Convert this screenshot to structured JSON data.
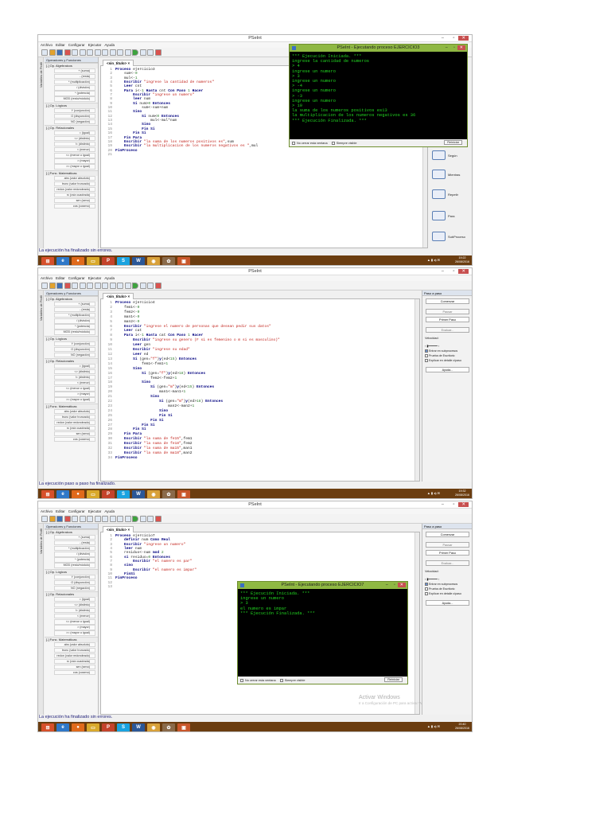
{
  "app": {
    "title": "PSeInt",
    "menu": [
      "Archivo",
      "Editar",
      "Configurar",
      "Ejecutar",
      "Ayuda"
    ],
    "editor_tab": "<sin_titulo>",
    "side_tab": "Operadores y Funciones",
    "side_vert": "Variables de Perfil"
  },
  "panel": {
    "groups": [
      {
        "title": "[-]  Op. Algebraicos",
        "items": [
          "+ (suma)",
          "- (resta)",
          "* (multiplicación)",
          "/ (división)",
          "^ (potencia)",
          "MOD (resto/módulo)"
        ]
      },
      {
        "title": "[-]  Op. Lógicos",
        "items": [
          "Y (conjunción)",
          "O (disyunción)",
          "NO (negación)"
        ]
      },
      {
        "title": "[-]  Op. Relacionales",
        "items": [
          "= (igual)",
          "<> (distinto)",
          "!= (distinto)",
          "< (menor)",
          "<= (menor o igual)",
          "> (mayor)",
          ">= (mayor o igual)"
        ]
      },
      {
        "title": "[-]  Func. Matemáticas",
        "items": [
          "abs (valor absoluto)",
          "trunc (valor truncado)",
          "redon (valor redondeado)",
          "rc (raíz cuadrada)",
          "sen (seno)",
          "cos (coseno)"
        ]
      }
    ]
  },
  "shot1": {
    "code": [
      [
        "1",
        "Proceso ejercicio3"
      ],
      [
        "2",
        "    sum<-0"
      ],
      [
        "3",
        "    mul<-1"
      ],
      [
        "4",
        "    Escribir \"ingrese la cantidad de numeros\""
      ],
      [
        "5",
        "    Leer cnt"
      ],
      [
        "6",
        "    Para i<-1 Hasta cnt Con Paso 1 Hacer"
      ],
      [
        "7",
        "        Escribir \"ingrese un numero\""
      ],
      [
        "8",
        "        leer num"
      ],
      [
        "9",
        "        Si num>0 Entonces"
      ],
      [
        "10",
        "            sum<-sum+num"
      ],
      [
        "11",
        "        Sino"
      ],
      [
        "12",
        "            Si num<0 Entonces"
      ],
      [
        "13",
        "                mul<-mul*num"
      ],
      [
        "14",
        "            Sino"
      ],
      [
        "15",
        "            Fin Si"
      ],
      [
        "16",
        "        Fin Si"
      ],
      [
        "17",
        "    Fin Para"
      ],
      [
        "18",
        "    Escribir \"la suma de los numeros positivos es\",sum"
      ],
      [
        "19",
        "    Escribir \"la multiplicacion de los numeros negativos es \",mul"
      ],
      [
        "20",
        "FinProceso"
      ],
      [
        "21",
        ""
      ]
    ],
    "status": "La ejecución ha finalizado sin errores.",
    "console": {
      "title": "PSeInt - Ejecutando proceso EJERCICIO3",
      "lines": [
        "*** Ejecución Iniciada. ***",
        "ingrese la cantidad de numeros",
        "> 4",
        "ingrese un numero",
        "> 3",
        "ingrese un numero",
        "> -4",
        "ingrese un numero",
        "> -3",
        "ingrese un numero",
        "> 10",
        "la suma de los numeros positivos es13",
        "la multiplicacion de los numeros negativos es 36",
        "*** Ejecución Finalizada. ***"
      ],
      "no_cerrar": "No cerrar esta ventana",
      "siempre": "Siempre visible",
      "reiniciar": "Reiniciar"
    },
    "mini_buttons": [
      "Según",
      "Mientras",
      "Repetir",
      "Para",
      "SubProceso"
    ],
    "clock": "19:22",
    "date": "26/08/2016"
  },
  "shot2": {
    "code": [
      [
        "1",
        "Proceso ejercicio4"
      ],
      [
        "2",
        "    fem1<-0"
      ],
      [
        "3",
        "    fem2<-0"
      ],
      [
        "4",
        "    man1<-0"
      ],
      [
        "5",
        "    man2<-0"
      ],
      [
        "6",
        "    Escribir \"ingrese el numero de personas que desean pedir sus datos\""
      ],
      [
        "7",
        "    Leer cat"
      ],
      [
        "8",
        "    Para i<-1 Hasta cat Con Paso 1 Hacer"
      ],
      [
        "9",
        "        Escribir \"ingrese su genero (F si es femenino o m si es masculino)\""
      ],
      [
        "10",
        "        Leer gen"
      ],
      [
        "11",
        "        Escribir \"ingrese su edad\""
      ],
      [
        "12",
        "        Leer ed"
      ],
      [
        "13",
        "        Si (gen=\"f\")y(ed<15) Entonces"
      ],
      [
        "14",
        "            fem1<-fem1+1"
      ],
      [
        "15",
        "        Sino"
      ],
      [
        "16",
        "            Si (gen=\"f\")y(ed>18) Entonces"
      ],
      [
        "17",
        "                fem2<-fem2+1"
      ],
      [
        "18",
        "            Sino"
      ],
      [
        "19",
        "                Si (gen=\"m\")y(ed<15) Entonces"
      ],
      [
        "20",
        "                    man1<-man1+1"
      ],
      [
        "21",
        "                Sino"
      ],
      [
        "22",
        "                    Si (gen=\"m\")y(ed>18) Entonces"
      ],
      [
        "23",
        "                        man2<-man2+1"
      ],
      [
        "24",
        "                    Sino"
      ],
      [
        "25",
        "                    Fin Si"
      ],
      [
        "26",
        "                Fin Si"
      ],
      [
        "27",
        "            Fin Si"
      ],
      [
        "28",
        "        Fin Si"
      ],
      [
        "29",
        "    Fin Para"
      ],
      [
        "30",
        "    Escribir \"la suma de fe15\",fem1"
      ],
      [
        "31",
        "    Escribir \"la suma de fe18\",fem2"
      ],
      [
        "32",
        "    Escribir \"la suma de ma15\",man1"
      ],
      [
        "33",
        "    Escribir \"la suma de ma18\",man2"
      ],
      [
        "34",
        "FinProceso"
      ]
    ],
    "status": "La ejecución paso a paso ha finalizado.",
    "clock": "19:32",
    "date": "26/08/2016"
  },
  "shot3": {
    "code": [
      [
        "1",
        "Proceso ejercicio7"
      ],
      [
        "2",
        "    definir num Como Real"
      ],
      [
        "3",
        "    Escribir \"ingrese un numero\""
      ],
      [
        "4",
        "    leer num"
      ],
      [
        "5",
        "    residuo<-num mod 2"
      ],
      [
        "6",
        "    si residuo=0 Entonces"
      ],
      [
        "7",
        "        Escribir \"el numero es par\""
      ],
      [
        "8",
        "    sino"
      ],
      [
        "9",
        "        Escribir \"el numero es impar\""
      ],
      [
        "10",
        "    FinSi"
      ],
      [
        "11",
        "FinProceso"
      ],
      [
        "12",
        ""
      ],
      [
        "13",
        ""
      ]
    ],
    "status": "La ejecución ha finalizado sin errores.",
    "console": {
      "title": "PSeInt - Ejecutando proceso EJERCICIO7",
      "lines": [
        "*** Ejecución Iniciada. ***",
        "ingrese un numero",
        "> 3",
        "el numero es impar",
        "*** Ejecución Finalizada. ***"
      ],
      "no_cerrar": "No cerrar esta ventana",
      "siempre": "Siempre visible",
      "reiniciar": "Reiniciar"
    },
    "watermark": "Activar Windows",
    "watermark_sub": "Ir a Configuración de PC para activar Windows.",
    "clock": "20:40",
    "date": "26/08/2016"
  },
  "step_panel": {
    "title": "Paso a paso",
    "comenzar": "Comenzar",
    "pausar": "Pausar",
    "primer_paso": "Primer Paso",
    "evaluar": "Evaluar...",
    "velocidad": "Velocidad:",
    "entrar": "Entrar en subprocesos",
    "prueba": "Prueba de Escritorio",
    "explicar": "Explicar en detalle c/paso",
    "ayuda": "Ayuda...",
    "vert": "Paso a paso / Variables y Ejecución"
  },
  "taskbar": {
    "icons": [
      "windows-start",
      "ie",
      "firefox",
      "explorer",
      "powerpoint",
      "skype",
      "word",
      "chrome",
      "tool",
      "pseint"
    ]
  }
}
